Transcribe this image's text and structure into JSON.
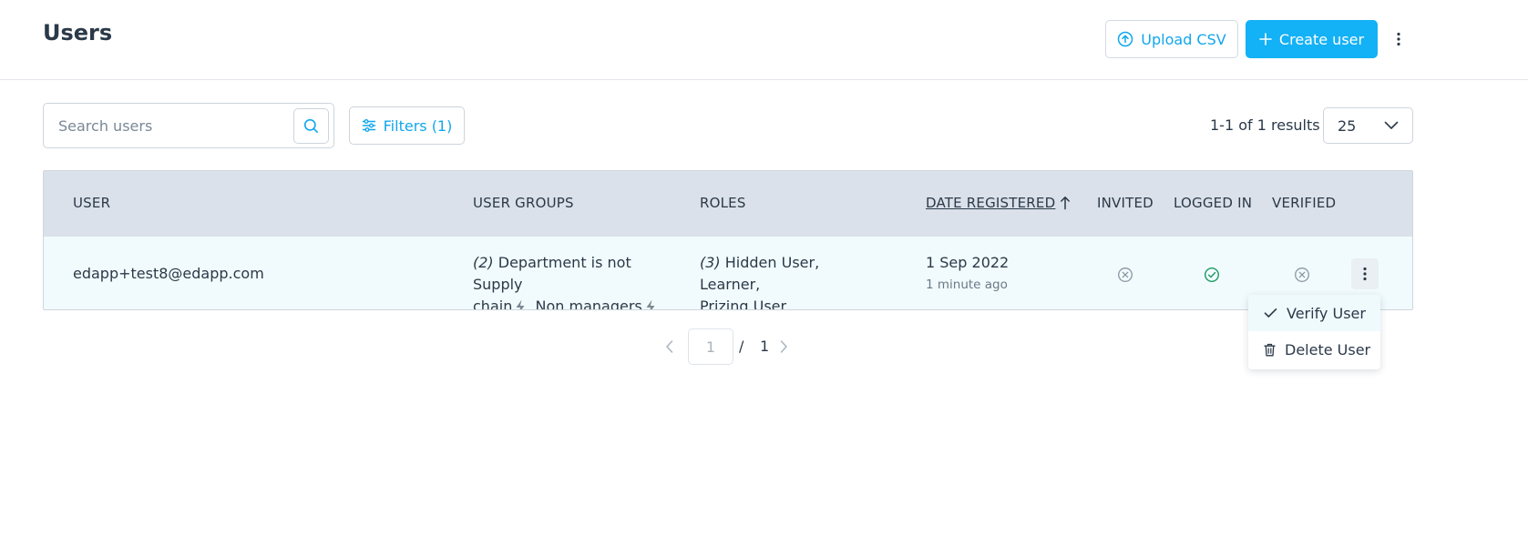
{
  "header": {
    "title": "Users",
    "upload_label": "Upload CSV",
    "create_label": "Create user"
  },
  "toolbar": {
    "search_placeholder": "Search users",
    "filters_label": "Filters (1)",
    "results_text": "1-1 of 1 results",
    "per_page": "25"
  },
  "table": {
    "columns": {
      "user": "USER",
      "user_groups": "USER GROUPS",
      "roles": "ROLES",
      "date_registered": "DATE REGISTERED",
      "invited": "INVITED",
      "logged_in": "LOGGED IN",
      "verified": "VERIFIED"
    },
    "rows": [
      {
        "email": "edapp+test8@edapp.com",
        "groups_count": "(2)",
        "groups_line1": "Department is not Supply",
        "groups_line2a": "chain",
        "groups_line2b": ", Non managers",
        "roles_count": "(3)",
        "roles_line1": "Hidden User, Learner,",
        "roles_line2": "Prizing User",
        "date": "1 Sep 2022",
        "date_relative": "1 minute ago",
        "invited": false,
        "logged_in": true,
        "verified": false
      }
    ]
  },
  "pagination": {
    "current": "1",
    "separator": "/",
    "total": "1"
  },
  "row_menu": {
    "items": [
      {
        "label": "Verify User",
        "icon": "check-icon"
      },
      {
        "label": "Delete User",
        "icon": "trash-icon"
      }
    ]
  },
  "colors": {
    "accent": "#13b1f5",
    "header_bg": "#dbe1ea",
    "row_bg": "#f1fbfd",
    "success": "#1a9a63",
    "muted_icon": "#8a96a3"
  }
}
